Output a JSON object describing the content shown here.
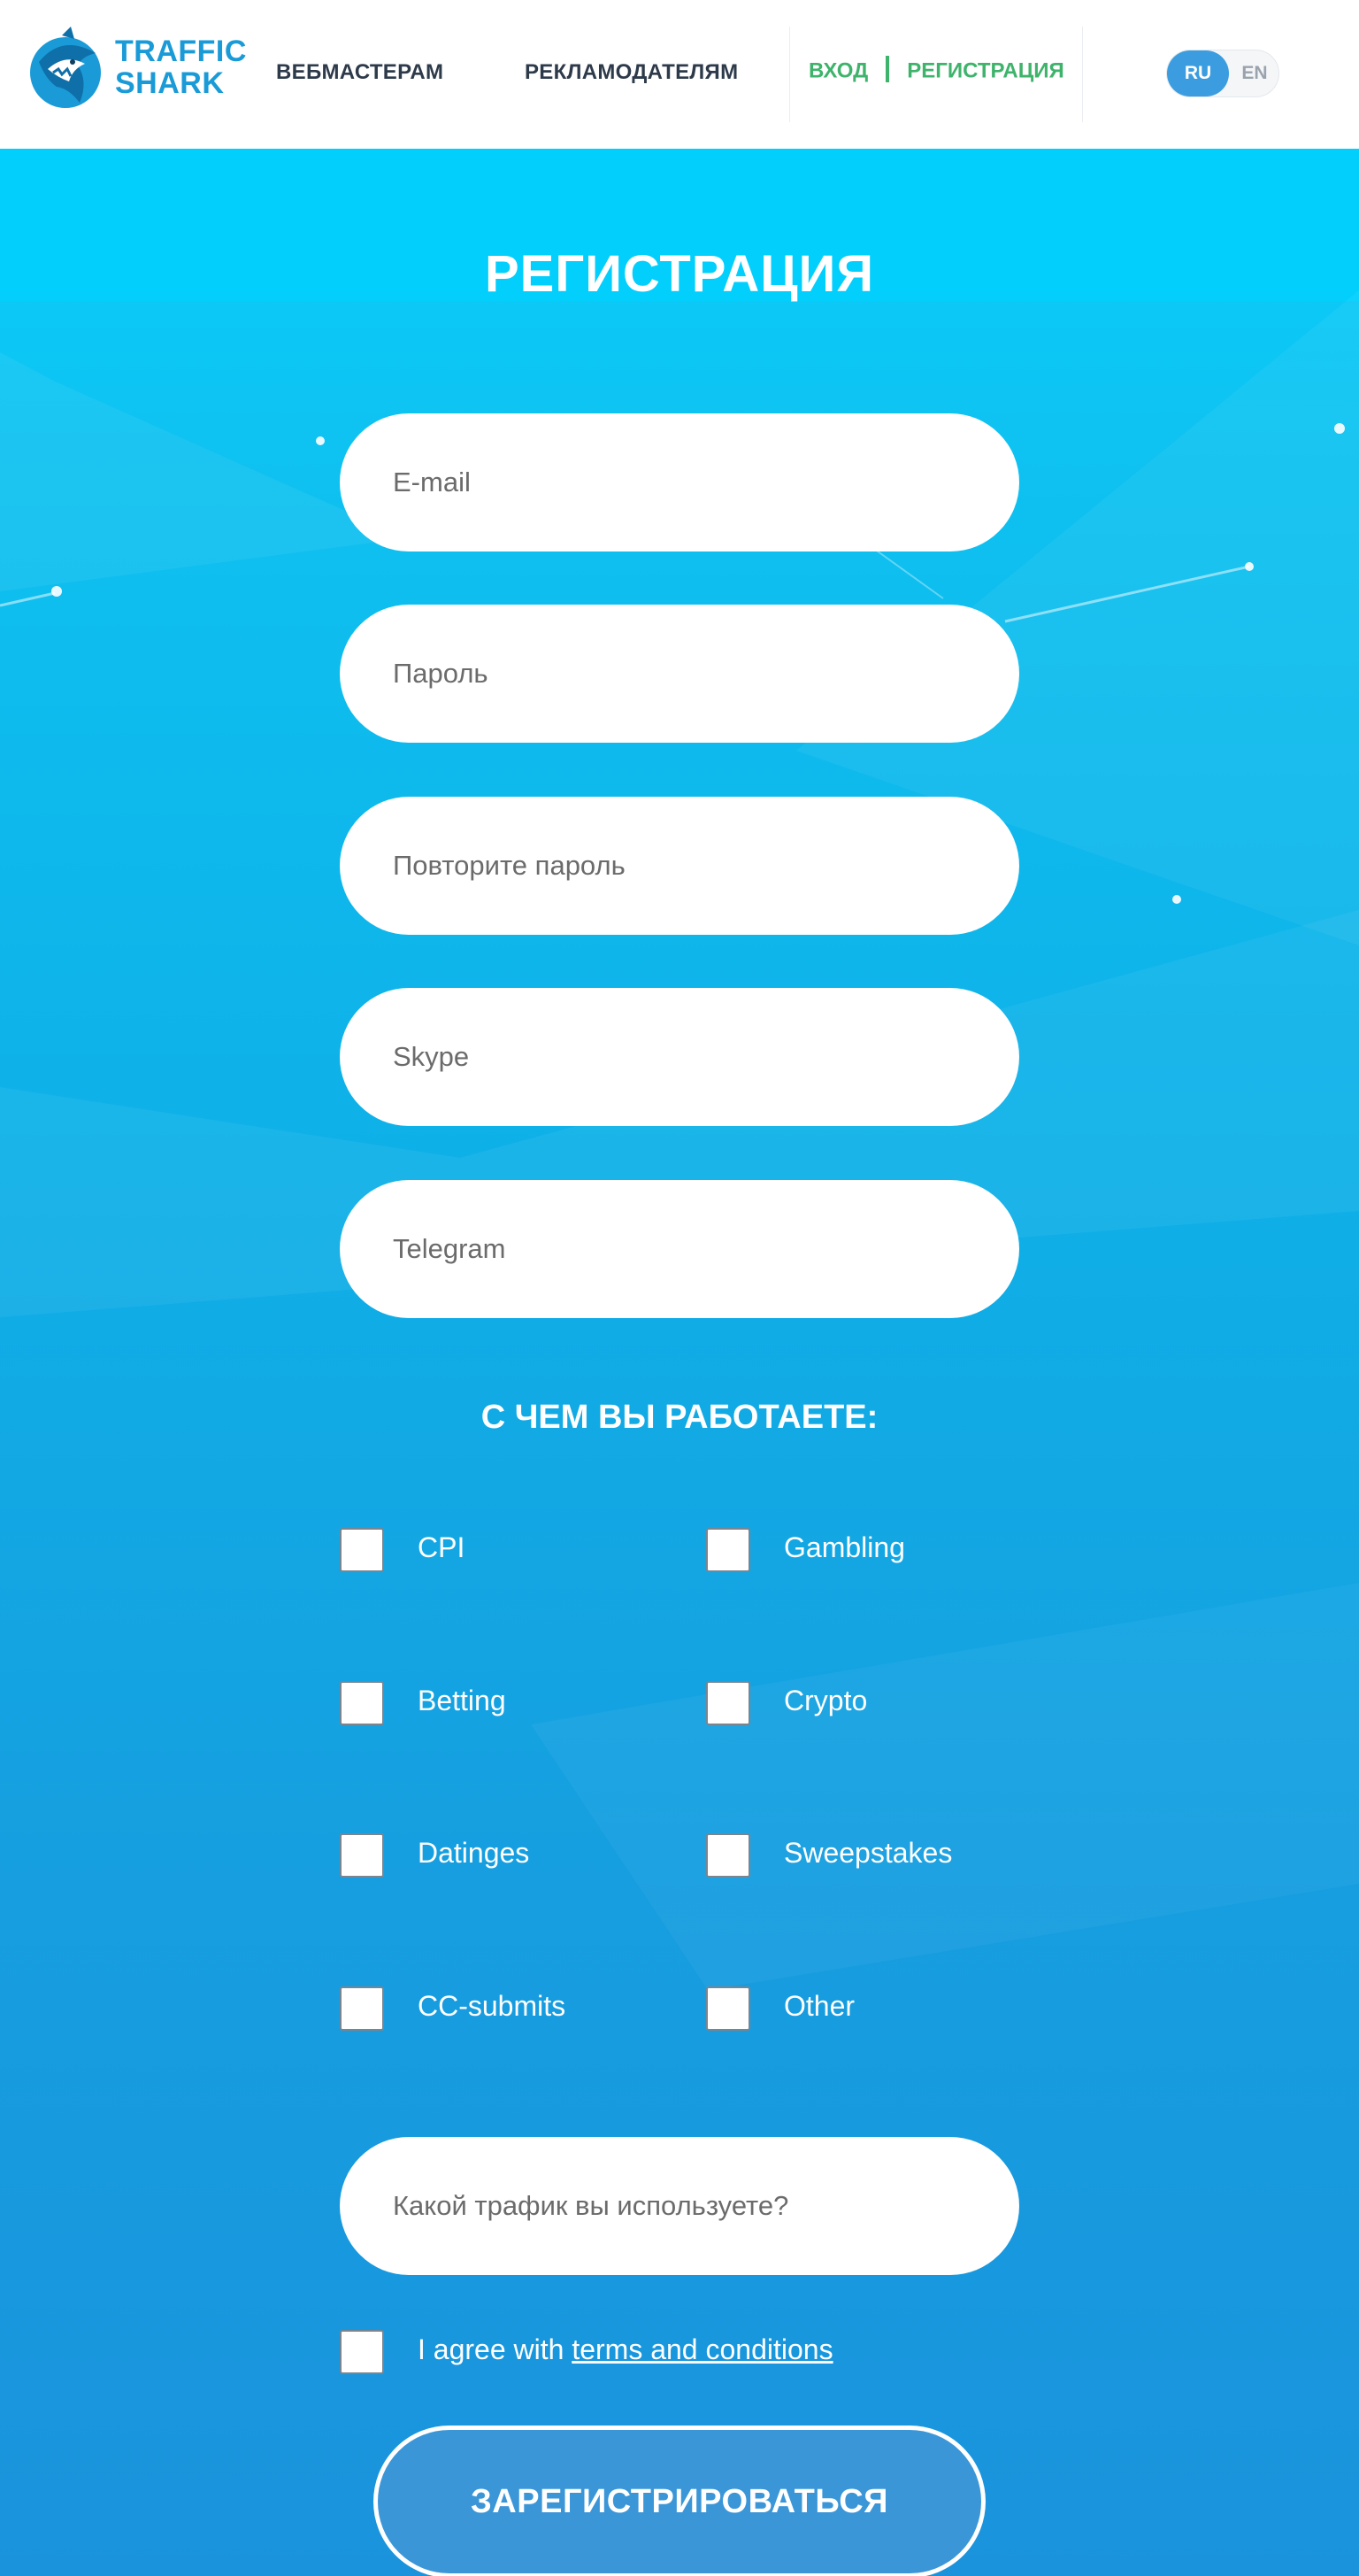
{
  "header": {
    "logo_line1": "TRAFFIC",
    "logo_line2": "SHARK",
    "nav": {
      "webmasters": "ВЕБМАСТЕРАМ",
      "advertisers": "РЕКЛАМОДАТЕЛЯМ"
    },
    "auth": {
      "login": "ВХОД",
      "register": "РЕГИСТРАЦИЯ"
    },
    "lang": {
      "active": "RU",
      "other": "EN"
    }
  },
  "form": {
    "title": "РЕГИСТРАЦИЯ",
    "fields": {
      "email_placeholder": "E-mail",
      "password_placeholder": "Пароль",
      "repeat_password_placeholder": "Повторите пароль",
      "skype_placeholder": "Skype",
      "telegram_placeholder": "Telegram",
      "traffic_placeholder": "Какой трафик вы используете?"
    },
    "work_title": "С ЧЕМ ВЫ РАБОТАЕТЕ:",
    "verticals": [
      "CPI",
      "Gambling",
      "Betting",
      "Crypto",
      "Datinges",
      "Sweepstakes",
      "CC-submits",
      "Other"
    ],
    "agree_prefix": "I agree with ",
    "agree_link": "terms and conditions",
    "submit_label": "ЗАРЕГИСТРИРОВАТЬСЯ"
  },
  "colors": {
    "brand_blue": "#1a9bd7",
    "accent_green": "#3eb36b",
    "lang_active": "#3b9de0",
    "submit_fill": "#3b96d8"
  }
}
